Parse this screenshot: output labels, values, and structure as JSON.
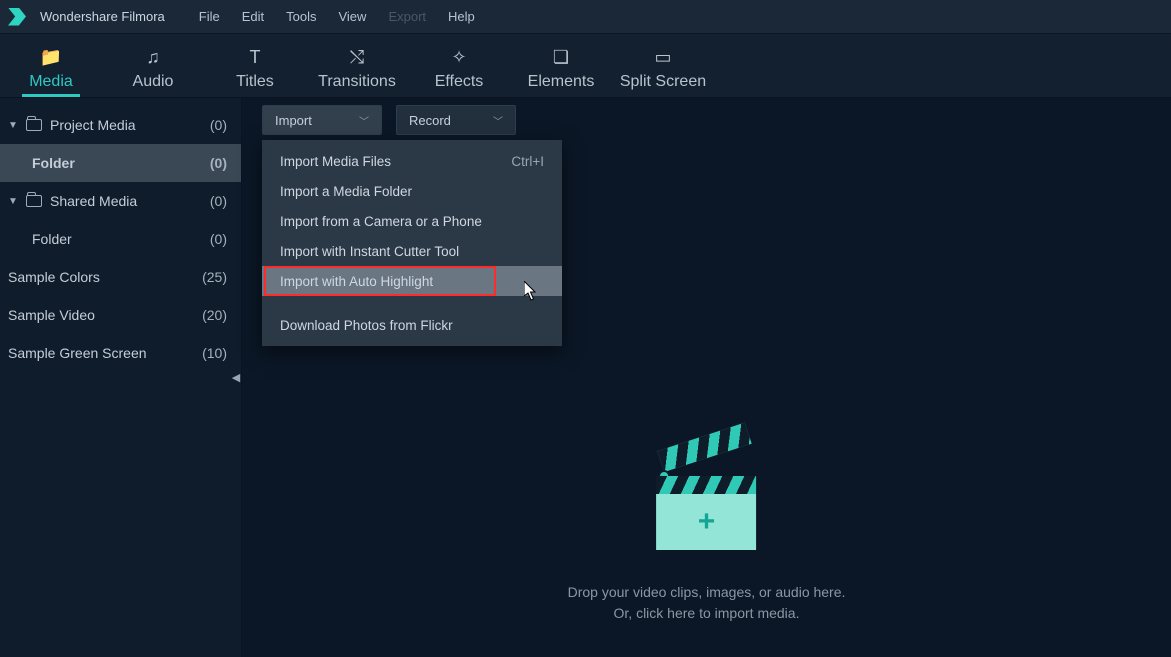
{
  "app_title": "Wondershare Filmora",
  "menubar": {
    "file": "File",
    "edit": "Edit",
    "tools": "Tools",
    "view": "View",
    "export": "Export",
    "help": "Help"
  },
  "tabs": {
    "media": "Media",
    "audio": "Audio",
    "titles": "Titles",
    "transitions": "Transitions",
    "effects": "Effects",
    "elements": "Elements",
    "split_screen": "Split Screen"
  },
  "sidebar": {
    "project_media": {
      "label": "Project Media",
      "count": "(0)"
    },
    "folder_selected": {
      "label": "Folder",
      "count": "(0)"
    },
    "shared_media": {
      "label": "Shared Media",
      "count": "(0)"
    },
    "folder2": {
      "label": "Folder",
      "count": "(0)"
    },
    "sample_colors": {
      "label": "Sample Colors",
      "count": "(25)"
    },
    "sample_video": {
      "label": "Sample Video",
      "count": "(20)"
    },
    "sample_green": {
      "label": "Sample Green Screen",
      "count": "(10)"
    }
  },
  "toolbar": {
    "import": "Import",
    "record": "Record"
  },
  "import_menu": {
    "media_files": "Import Media Files",
    "media_files_shortcut": "Ctrl+I",
    "media_folder": "Import a Media Folder",
    "camera_phone": "Import from a Camera or a Phone",
    "instant_cutter": "Import with Instant Cutter Tool",
    "auto_highlight": "Import with Auto Highlight",
    "flickr": "Download Photos from Flickr"
  },
  "dropzone": {
    "line1": "Drop your video clips, images, or audio here.",
    "line2": "Or, click here to import media."
  }
}
